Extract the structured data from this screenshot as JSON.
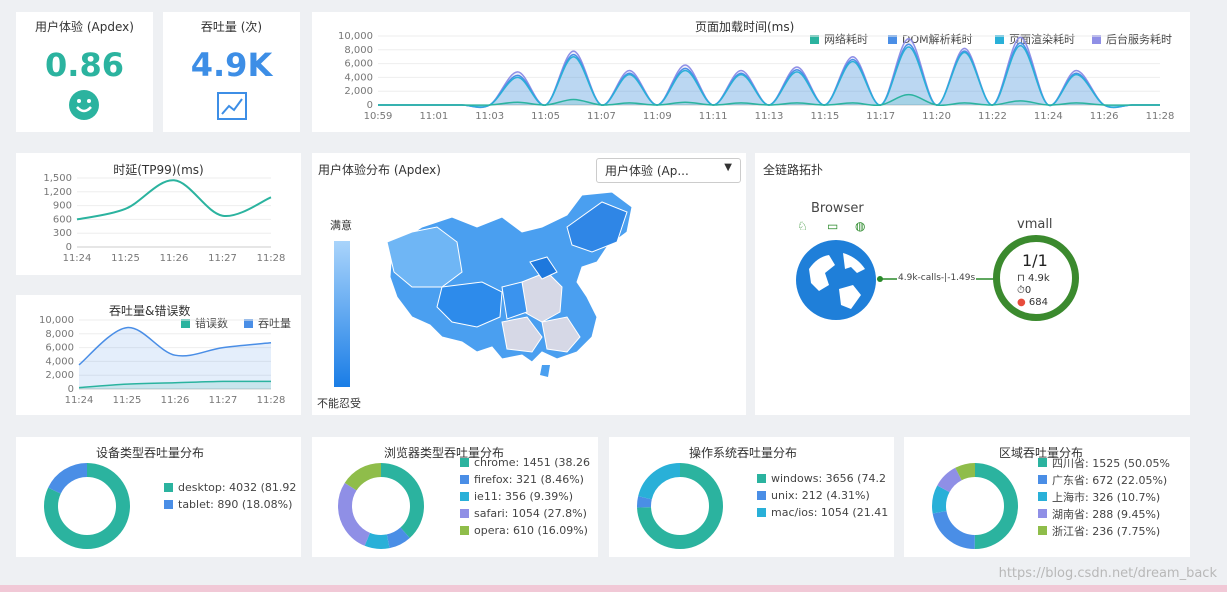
{
  "apdex": {
    "title": "用户体验 (Apdex)",
    "value": "0.86",
    "icon": "smiley-icon"
  },
  "throughput_card": {
    "title": "吞吐量 (次)",
    "value": "4.9K",
    "icon": "trend-chart-icon"
  },
  "page_load": {
    "title": "页面加载时间(ms)",
    "legend": [
      "网络耗时",
      "DOM解析耗时",
      "页面渲染耗时",
      "后台服务耗时"
    ],
    "colors": [
      "#2bb39f",
      "#4a8ee6",
      "#29b0d8",
      "#8f8fe6"
    ]
  },
  "latency": {
    "title": "时延(TP99)(ms)"
  },
  "tp_err": {
    "title": "吞吐量&错误数",
    "legend": [
      "错误数",
      "吞吐量"
    ],
    "colors": [
      "#2bb39f",
      "#4a8ee6"
    ]
  },
  "map_panel": {
    "title": "用户体验分布 (Apdex)",
    "dropdown": "用户体验 (Ap...",
    "scale_top": "满意",
    "scale_bottom": "不能忍受"
  },
  "topology": {
    "title": "全链路拓扑",
    "browser_label": "Browser",
    "node_name": "vmall",
    "node_ratio": "1/1",
    "calls": "4.9k-calls-|-1.49s",
    "stat_tp": "4.9k",
    "stat_zero": "0",
    "stat_err": "684"
  },
  "device": {
    "title": "设备类型吞吐量分布",
    "items": [
      "desktop: 4032 (81.92",
      "tablet: 890 (18.08%)"
    ]
  },
  "browser": {
    "title": "浏览器类型吞吐量分布",
    "items": [
      "chrome: 1451 (38.26",
      "firefox: 321 (8.46%)",
      "ie11: 356 (9.39%)",
      "safari: 1054 (27.8%)",
      "opera: 610 (16.09%)"
    ]
  },
  "os": {
    "title": "操作系统吞吐量分布",
    "items": [
      "windows: 3656 (74.2",
      "unix: 212 (4.31%)",
      "mac/ios: 1054 (21.41"
    ]
  },
  "region": {
    "title": "区域吞吐量分布",
    "items": [
      "四川省: 1525 (50.05%",
      "广东省: 672 (22.05%)",
      "上海市: 326 (10.7%)",
      "湖南省: 288 (9.45%)",
      "浙江省: 236 (7.75%)"
    ]
  },
  "watermark": "https://blog.csdn.net/dream_back",
  "chart_data": [
    {
      "type": "area",
      "title": "页面加载时间(ms)",
      "x": [
        "10:59",
        "11:00",
        "11:01",
        "11:02",
        "11:03",
        "11:04",
        "11:05",
        "11:06",
        "11:07",
        "11:08",
        "11:09",
        "11:10",
        "11:11",
        "11:12",
        "11:13",
        "11:14",
        "11:15",
        "11:16",
        "11:17",
        "11:18",
        "11:20",
        "11:21",
        "11:22",
        "11:23",
        "11:24",
        "11:25",
        "11:26",
        "11:27",
        "11:28"
      ],
      "xticks": [
        "10:59",
        "11:01",
        "11:03",
        "11:05",
        "11:07",
        "11:09",
        "11:11",
        "11:13",
        "11:15",
        "11:17",
        "11:20",
        "11:22",
        "11:24",
        "11:26",
        "11:28"
      ],
      "yticks": [
        "10,000",
        "8,000",
        "6,000",
        "4,000",
        "2,000",
        "0"
      ],
      "ylim": [
        0,
        10000
      ],
      "series": [
        {
          "name": "后台服务耗时",
          "values": [
            0,
            0,
            0,
            0,
            0,
            4800,
            0,
            7800,
            0,
            5000,
            0,
            5800,
            0,
            5000,
            0,
            5500,
            0,
            7000,
            0,
            9600,
            0,
            8200,
            0,
            9800,
            0,
            5000,
            0,
            0,
            0
          ]
        },
        {
          "name": "DOM解析耗时",
          "values": [
            0,
            0,
            0,
            0,
            0,
            4300,
            0,
            7300,
            0,
            4600,
            0,
            5300,
            0,
            4600,
            0,
            5100,
            0,
            6600,
            0,
            8800,
            0,
            7800,
            0,
            9000,
            0,
            4600,
            0,
            0,
            0
          ]
        },
        {
          "name": "页面渲染耗时",
          "values": [
            0,
            0,
            0,
            0,
            0,
            4000,
            0,
            7000,
            0,
            4400,
            0,
            5000,
            0,
            4400,
            0,
            4800,
            0,
            6300,
            0,
            8400,
            0,
            7600,
            0,
            8600,
            0,
            4400,
            0,
            0,
            0
          ]
        },
        {
          "name": "网络耗时",
          "values": [
            0,
            0,
            0,
            0,
            0,
            400,
            0,
            800,
            0,
            300,
            0,
            400,
            0,
            300,
            0,
            300,
            0,
            300,
            0,
            1500,
            0,
            300,
            0,
            600,
            0,
            300,
            0,
            0,
            0
          ]
        }
      ]
    },
    {
      "type": "line",
      "title": "时延(TP99)(ms)",
      "x": [
        "11:24",
        "11:25",
        "11:26",
        "11:27",
        "11:28"
      ],
      "yticks": [
        "1,500",
        "1,200",
        "900",
        "600",
        "300",
        "0"
      ],
      "ylim": [
        0,
        1500
      ],
      "series": [
        {
          "values": [
            600,
            830,
            1450,
            680,
            1080
          ]
        }
      ]
    },
    {
      "type": "area",
      "title": "吞吐量&错误数",
      "x": [
        "11:24",
        "11:25",
        "11:26",
        "11:27",
        "11:28"
      ],
      "yticks": [
        "10,000",
        "8,000",
        "6,000",
        "4,000",
        "2,000",
        "0"
      ],
      "ylim": [
        0,
        10000
      ],
      "series": [
        {
          "name": "吞吐量",
          "values": [
            3500,
            8900,
            4900,
            6000,
            6700
          ]
        },
        {
          "name": "错误数",
          "values": [
            200,
            700,
            900,
            1100,
            1100
          ]
        }
      ]
    },
    {
      "type": "pie",
      "title": "设备类型吞吐量分布",
      "labels": [
        "desktop",
        "tablet"
      ],
      "values": [
        4032,
        890
      ],
      "colors": [
        "#2bb39f",
        "#4a8ee6"
      ]
    },
    {
      "type": "pie",
      "title": "浏览器类型吞吐量分布",
      "labels": [
        "chrome",
        "firefox",
        "ie11",
        "safari",
        "opera"
      ],
      "values": [
        1451,
        321,
        356,
        1054,
        610
      ],
      "colors": [
        "#2bb39f",
        "#4a8ee6",
        "#29b0d8",
        "#8f8fe6",
        "#8fbd4a"
      ]
    },
    {
      "type": "pie",
      "title": "操作系统吞吐量分布",
      "labels": [
        "windows",
        "unix",
        "mac/ios"
      ],
      "values": [
        3656,
        212,
        1054
      ],
      "colors": [
        "#2bb39f",
        "#4a8ee6",
        "#29b0d8"
      ]
    },
    {
      "type": "pie",
      "title": "区域吞吐量分布",
      "labels": [
        "四川省",
        "广东省",
        "上海市",
        "湖南省",
        "浙江省"
      ],
      "values": [
        1525,
        672,
        326,
        288,
        236
      ],
      "colors": [
        "#2bb39f",
        "#4a8ee6",
        "#29b0d8",
        "#8f8fe6",
        "#8fbd4a"
      ]
    }
  ]
}
